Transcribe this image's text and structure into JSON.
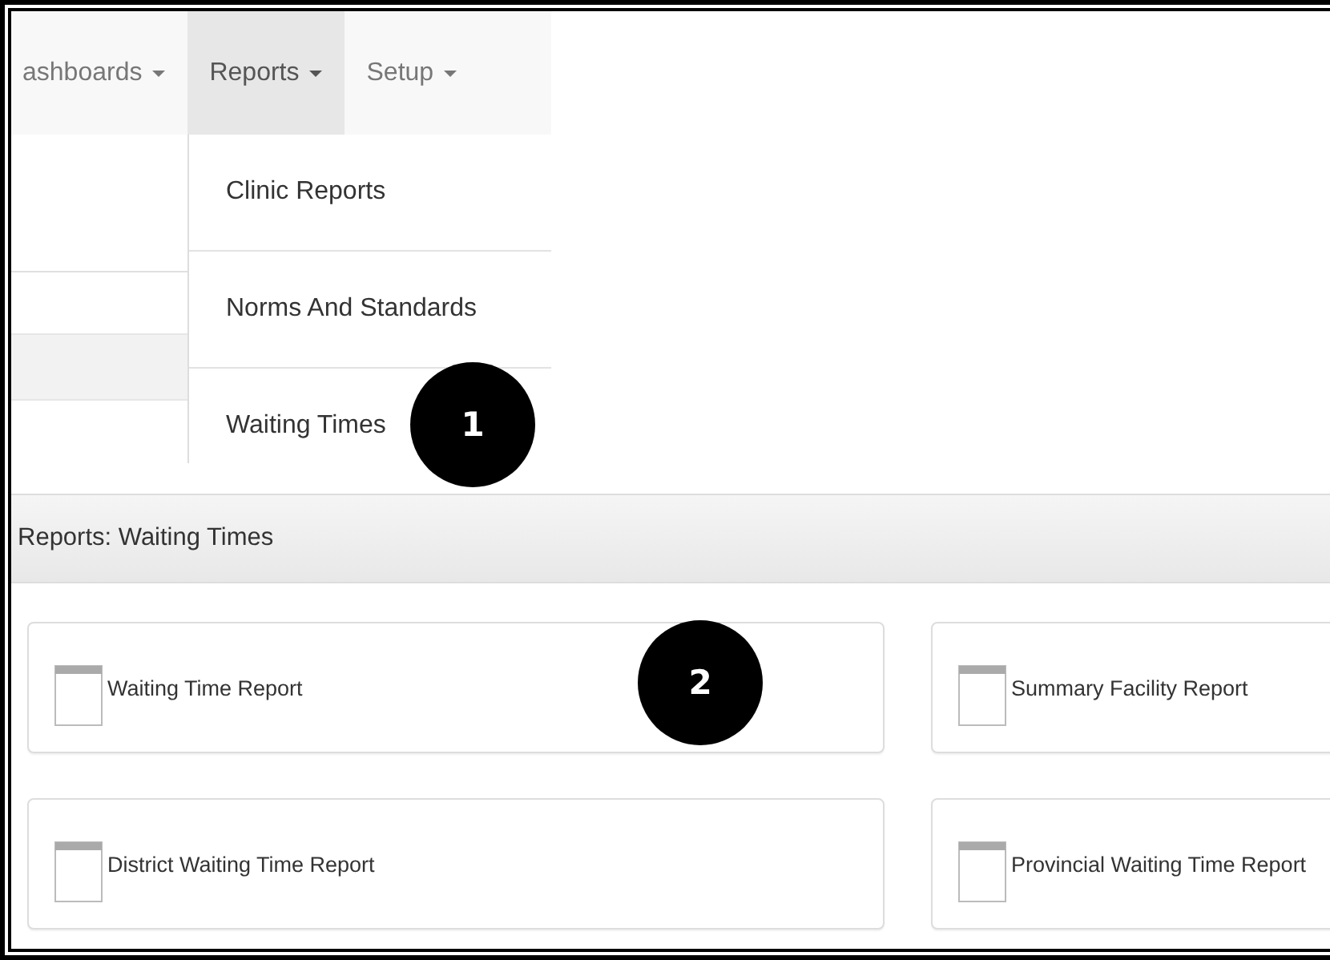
{
  "nav": {
    "items": [
      {
        "label": "ashboards",
        "selected": false
      },
      {
        "label": "Reports",
        "selected": true
      },
      {
        "label": "Setup",
        "selected": false
      }
    ]
  },
  "dropdown": {
    "items": [
      {
        "label": "Clinic Reports"
      },
      {
        "label": "Norms And Standards"
      },
      {
        "label": "Waiting Times"
      }
    ]
  },
  "callouts": [
    {
      "number": "1"
    },
    {
      "number": "2"
    }
  ],
  "panel": {
    "title": "Reports: Waiting Times",
    "reports": [
      {
        "label": "Waiting Time Report"
      },
      {
        "label": "Summary Facility Report"
      },
      {
        "label": "District Waiting Time Report"
      },
      {
        "label": "Provincial Waiting Time Report"
      }
    ]
  }
}
